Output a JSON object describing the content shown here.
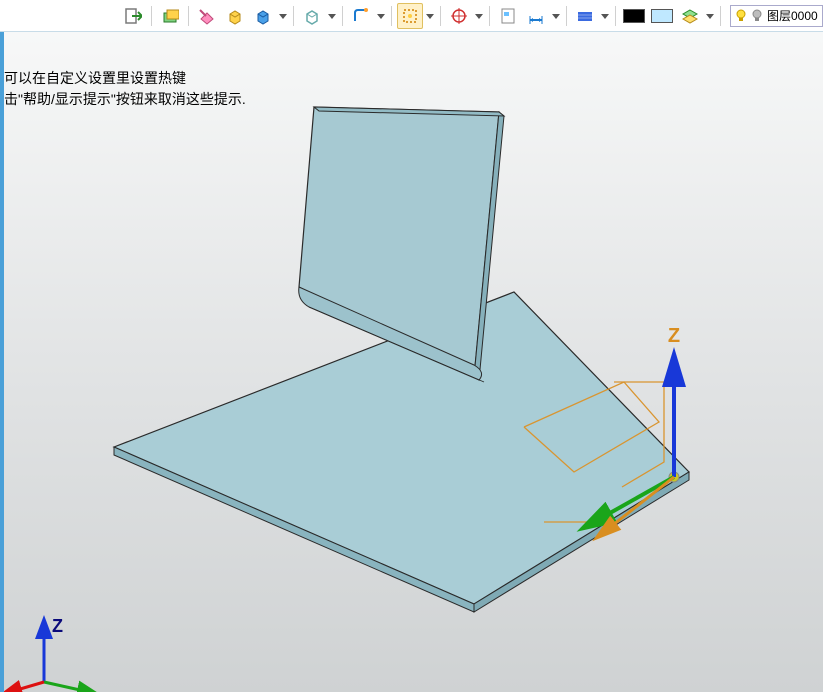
{
  "toolbar": {
    "layer_label": "图层0000",
    "icons": [
      "exit-icon",
      "sheets-icon",
      "eraser-icon",
      "box-yellow-icon",
      "box-blue-icon",
      "cube-wire-icon",
      "bend-icon",
      "select-rect-icon",
      "target-icon",
      "page-icon",
      "dimension-icon",
      "surface-icon",
      "color-black-icon",
      "color-skyblue-icon",
      "layers-icon"
    ]
  },
  "hints": {
    "line1": "可以在自定义设置里设置热键",
    "line2": "击\"帮助/显示提示\"按钮来取消这些提示."
  },
  "scene": {
    "main_axis_z": "Z",
    "mini_axis_z": "Z"
  }
}
